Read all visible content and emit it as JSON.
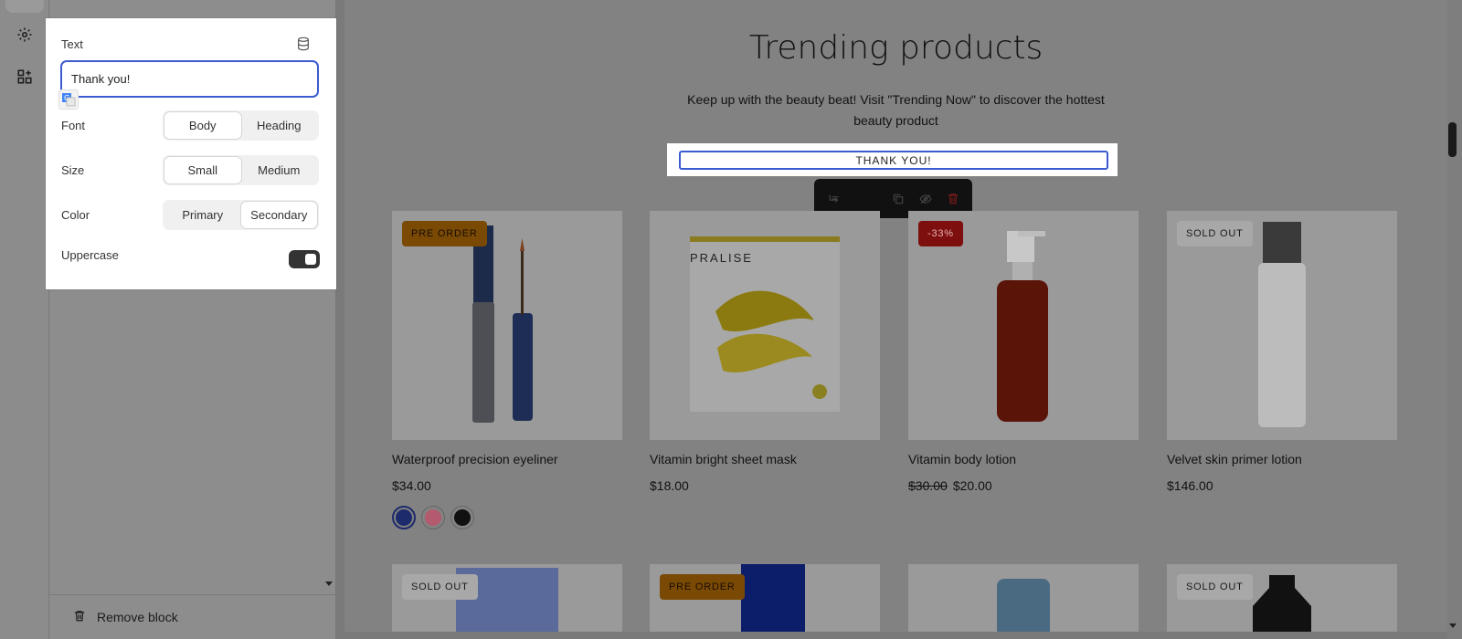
{
  "rail": {
    "icons": [
      "settings-icon",
      "apps-icon"
    ]
  },
  "panel": {
    "text_label": "Text",
    "text_value": "Thank you!",
    "font_label": "Font",
    "font_options": [
      "Body",
      "Heading"
    ],
    "font_selected": "Body",
    "size_label": "Size",
    "size_options": [
      "Small",
      "Medium"
    ],
    "size_selected": "Small",
    "color_label": "Color",
    "color_options": [
      "Primary",
      "Secondary"
    ],
    "color_selected": "Secondary",
    "uppercase_label": "Uppercase",
    "uppercase_on": true
  },
  "sidebar": {
    "remove_block_label": "Remove block"
  },
  "preview": {
    "heading": "Trending products",
    "description": "Keep up with the beauty beat! Visit \"Trending Now\" to discover the hottest beauty product",
    "selected_block_text": "THANK YOU!",
    "products_row1": [
      {
        "badge": "PRE ORDER",
        "badge_type": "preorder",
        "title": "Waterproof precision eyeliner",
        "price": "$34.00",
        "compare_price": ""
      },
      {
        "badge": "",
        "badge_type": "",
        "title": "Vitamin bright sheet mask",
        "price": "$18.00",
        "compare_price": ""
      },
      {
        "badge": "-33%",
        "badge_type": "sale",
        "title": "Vitamin body lotion",
        "price": "$20.00",
        "compare_price": "$30.00"
      },
      {
        "badge": "SOLD OUT",
        "badge_type": "soldout",
        "title": "Velvet skin primer lotion",
        "price": "$146.00",
        "compare_price": ""
      }
    ],
    "products_row2_badges": [
      "SOLD OUT",
      "PRE ORDER",
      "",
      "SOLD OUT"
    ],
    "product_brand": "PRALISE",
    "swatch_colors": [
      "#1d2a6b",
      "#b45a6e",
      "#111111"
    ]
  },
  "colors": {
    "accent": "#3b5bd0",
    "danger": "#c62828"
  }
}
